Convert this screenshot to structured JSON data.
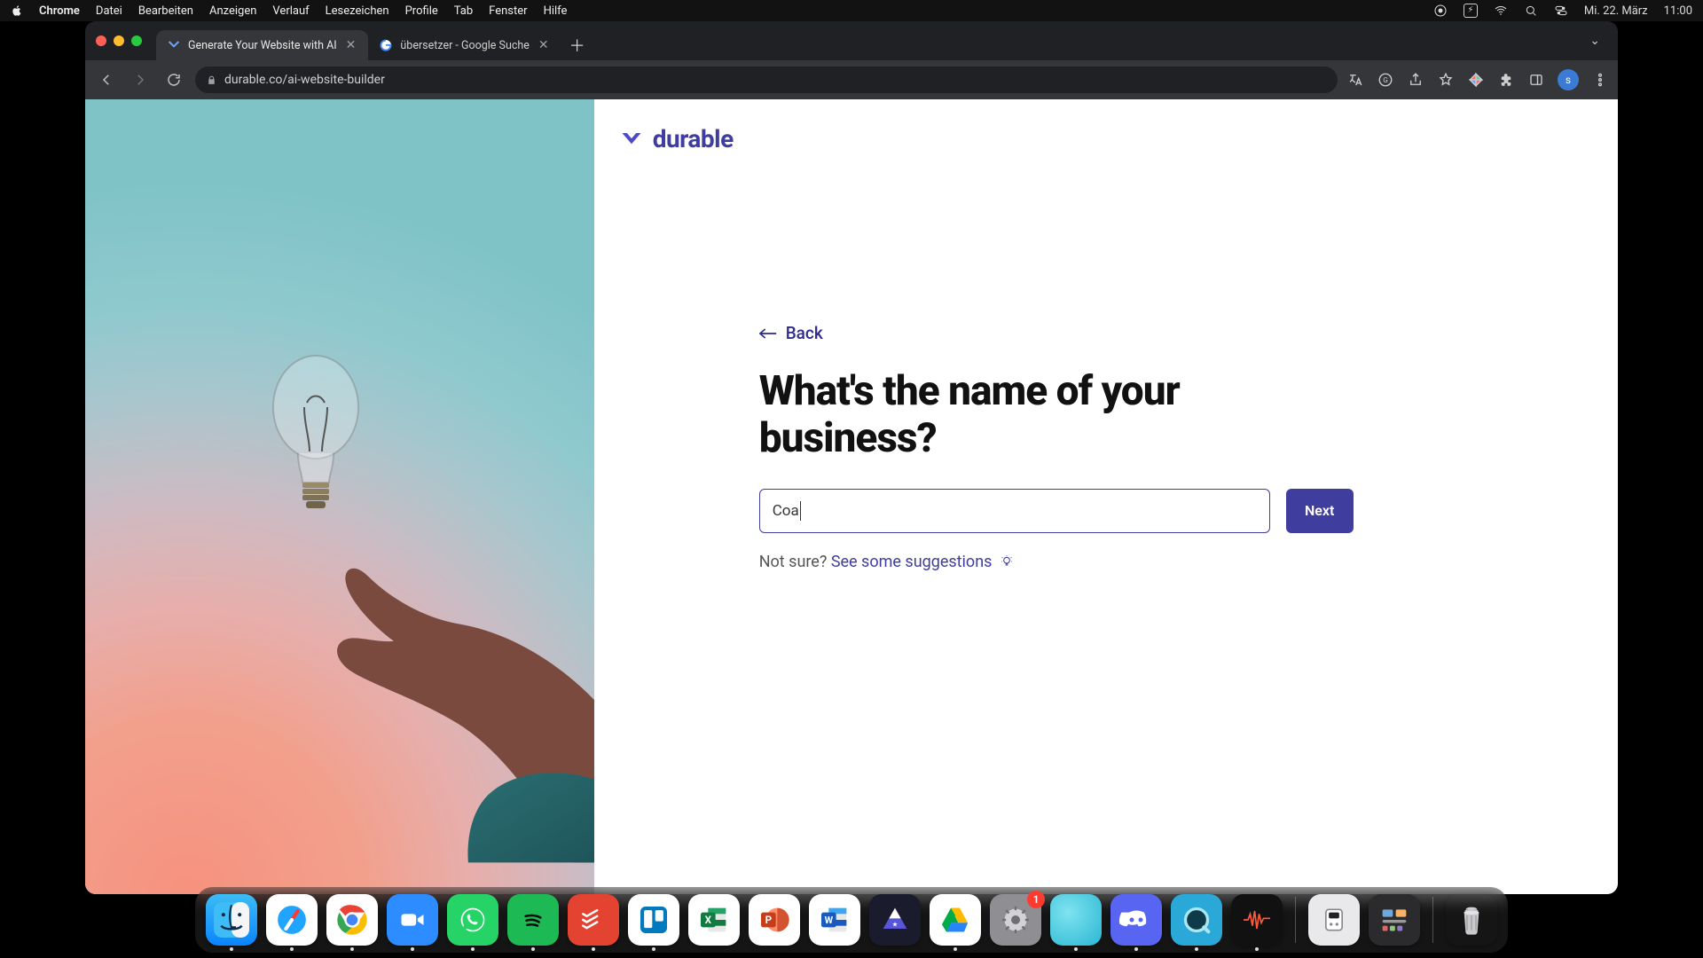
{
  "menubar": {
    "app": "Chrome",
    "items": [
      "Datei",
      "Bearbeiten",
      "Anzeigen",
      "Verlauf",
      "Lesezeichen",
      "Profile",
      "Tab",
      "Fenster",
      "Hilfe"
    ],
    "date": "Mi. 22. März",
    "time": "11:00"
  },
  "browser": {
    "tabs": [
      {
        "title": "Generate Your Website with AI",
        "active": true,
        "favicon": "durable"
      },
      {
        "title": "übersetzer - Google Suche",
        "active": false,
        "favicon": "google"
      }
    ],
    "url": "durable.co/ai-website-builder",
    "profile_initial": "s"
  },
  "page": {
    "brand": "durable",
    "back_label": "Back",
    "headline": "What's the name of your business?",
    "input_value": "Coa",
    "next_label": "Next",
    "not_sure_prefix": "Not sure? ",
    "suggestions_link": "See some suggestions"
  },
  "dock": {
    "apps": [
      {
        "name": "finder",
        "running": true
      },
      {
        "name": "safari",
        "running": true
      },
      {
        "name": "chrome",
        "running": true
      },
      {
        "name": "zoom",
        "running": true
      },
      {
        "name": "whatsapp",
        "running": true
      },
      {
        "name": "spotify",
        "running": true
      },
      {
        "name": "todoist",
        "running": true
      },
      {
        "name": "trello",
        "running": true
      },
      {
        "name": "excel",
        "running": false
      },
      {
        "name": "powerpoint",
        "running": false
      },
      {
        "name": "word",
        "running": false
      },
      {
        "name": "imovie",
        "running": false
      },
      {
        "name": "drive",
        "running": true
      },
      {
        "name": "settings",
        "running": false,
        "badge": "1"
      },
      {
        "name": "circle-app",
        "running": true
      },
      {
        "name": "discord",
        "running": true
      },
      {
        "name": "quicktime",
        "running": true
      },
      {
        "name": "audio-app",
        "running": true
      }
    ],
    "recent": [
      {
        "name": "utility"
      },
      {
        "name": "dock-expose"
      }
    ],
    "trash": {
      "name": "trash"
    }
  }
}
